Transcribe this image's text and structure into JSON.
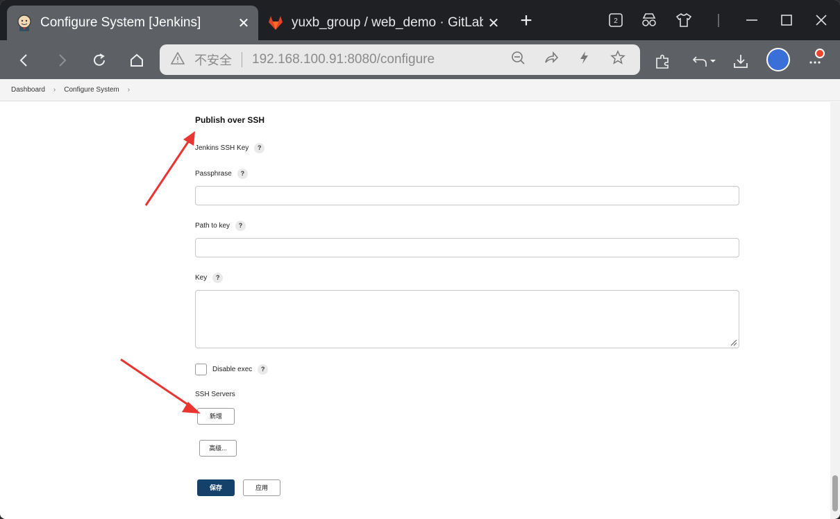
{
  "tabs": [
    {
      "title": "Configure System [Jenkins]",
      "icon": "jenkins-icon",
      "active": true,
      "close": "✕"
    },
    {
      "title": "yuxb_group / web_demo · GitLab",
      "icon": "gitlab-icon",
      "active": false,
      "close": "✕"
    }
  ],
  "window": {
    "tab_count": "2",
    "new_tab": "+"
  },
  "address": {
    "security_label": "不安全",
    "url": "192.168.100.91:8080/configure"
  },
  "breadcrumb": {
    "items": [
      "Dashboard",
      "Configure System"
    ]
  },
  "section": {
    "title": "Publish over SSH"
  },
  "fields": {
    "jenkins_ssh_key": "Jenkins SSH Key",
    "passphrase": "Passphrase",
    "path_to_key": "Path to key",
    "key": "Key",
    "disable_exec": "Disable exec",
    "ssh_servers": "SSH Servers",
    "help": "?"
  },
  "buttons": {
    "add": "新增",
    "advanced": "高级...",
    "save": "保存",
    "apply": "应用"
  },
  "colors": {
    "primary_button": "#134169",
    "annotation_arrow": "#e8352f"
  }
}
